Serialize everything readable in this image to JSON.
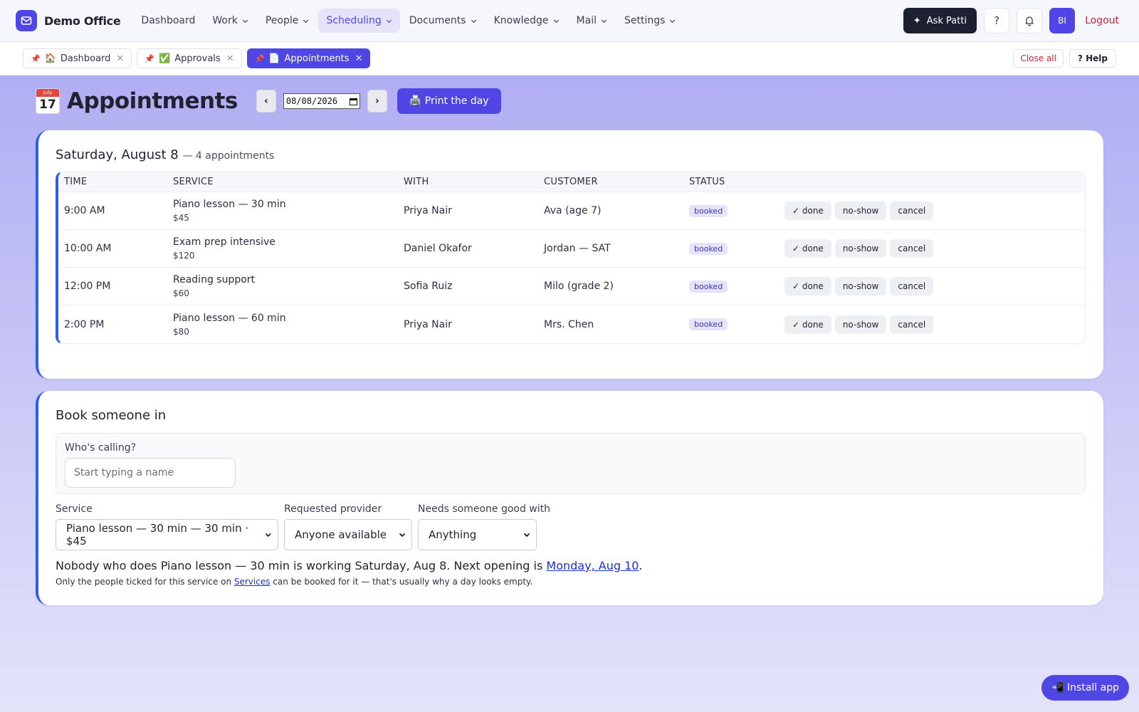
{
  "brand": {
    "name": "Demo Office",
    "logo_icon": "mail-icon"
  },
  "nav": {
    "items": [
      {
        "label": "Dashboard",
        "dropdown": false,
        "active": false
      },
      {
        "label": "Work",
        "dropdown": true,
        "active": false
      },
      {
        "label": "People",
        "dropdown": true,
        "active": false
      },
      {
        "label": "Scheduling",
        "dropdown": true,
        "active": true
      },
      {
        "label": "Documents",
        "dropdown": true,
        "active": false
      },
      {
        "label": "Knowledge",
        "dropdown": true,
        "active": false
      },
      {
        "label": "Mail",
        "dropdown": true,
        "active": false
      },
      {
        "label": "Settings",
        "dropdown": true,
        "active": false
      }
    ],
    "ask_label": "Ask Patti",
    "help_symbol": "?",
    "avatar_initials": "BI",
    "logout_label": "Logout"
  },
  "tabs": {
    "items": [
      {
        "pin": "📌",
        "emoji": "🏠",
        "label": "Dashboard",
        "active": false
      },
      {
        "pin": "📌",
        "emoji": "✅",
        "label": "Approvals",
        "active": false
      },
      {
        "pin": "📌",
        "emoji": "📄",
        "label": "Appointments",
        "active": true
      }
    ],
    "close_all_label": "Close all",
    "help_label": "? Help"
  },
  "page": {
    "calendar_month": "July",
    "calendar_day": "17",
    "title": "Appointments",
    "prev_label": "‹",
    "next_label": "›",
    "date_value": "08/08/2026",
    "print_label": "🖨️ Print the day"
  },
  "day": {
    "heading": "Saturday, August 8",
    "count_text": "— 4 appointments",
    "columns": [
      "TIME",
      "SERVICE",
      "WITH",
      "CUSTOMER",
      "STATUS"
    ],
    "action_labels": [
      "✓ done",
      "no-show",
      "cancel"
    ],
    "rows": [
      {
        "time": "9:00 AM",
        "service": "Piano lesson — 30 min",
        "price": "$45",
        "with": "Priya Nair",
        "customer": "Ava (age 7)",
        "status": "booked"
      },
      {
        "time": "10:00 AM",
        "service": "Exam prep intensive",
        "price": "$120",
        "with": "Daniel Okafor",
        "customer": "Jordan — SAT",
        "status": "booked"
      },
      {
        "time": "12:00 PM",
        "service": "Reading support",
        "price": "$60",
        "with": "Sofia Ruiz",
        "customer": "Milo (grade 2)",
        "status": "booked"
      },
      {
        "time": "2:00 PM",
        "service": "Piano lesson — 60 min",
        "price": "$80",
        "with": "Priya Nair",
        "customer": "Mrs. Chen",
        "status": "booked"
      }
    ]
  },
  "booking": {
    "title": "Book someone in",
    "caller_label": "Who's calling?",
    "caller_placeholder": "Start typing a name",
    "service_label": "Service",
    "service_value": "Piano lesson — 30 min — 30 min · $45",
    "provider_label": "Requested provider",
    "provider_value": "Anyone available",
    "skill_label": "Needs someone good with",
    "skill_value": "Anything",
    "note_prefix": "Nobody who does Piano lesson — 30 min is working Saturday, Aug 8. Next opening is ",
    "note_link": "Monday, Aug 10",
    "note_suffix": ".",
    "small_prefix": "Only the people ticked for this service on ",
    "small_link": "Services",
    "small_suffix": " can be booked for it — that's usually why a day looks empty."
  },
  "install_label": "📲 Install app",
  "colors": {
    "accent": "#4f46e5",
    "card_border": "#2f5fe6",
    "logout": "#c0283a",
    "badge_bg": "#e4e3fb"
  }
}
